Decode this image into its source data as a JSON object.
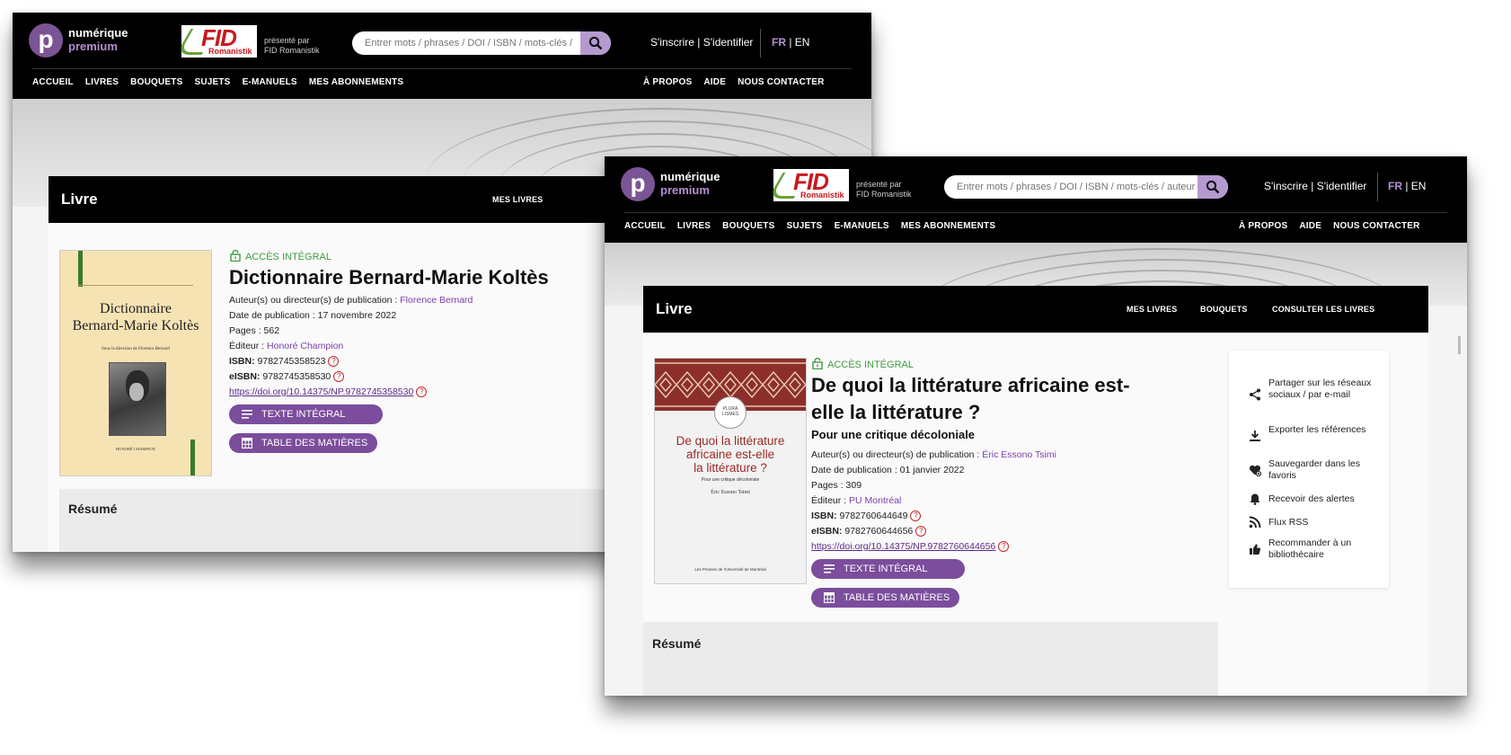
{
  "common": {
    "logo_line1": "numérique",
    "logo_line2": "premium",
    "fid_word": "FID",
    "fid_sub": "Romanistik",
    "presented_line1": "présenté par",
    "presented_line2": "FID Romanistik",
    "search_placeholder": "Entrer mots / phrases / DOI / ISBN / mots-clés / auteur",
    "signin": "S'inscrire | S'identifier",
    "lang_fr": "FR",
    "lang_sep": " | ",
    "lang_en": "EN",
    "nav_left": [
      "ACCUEIL",
      "LIVRES",
      "BOUQUETS",
      "SUJETS",
      "E-MANUELS",
      "MES ABONNEMENTS"
    ],
    "nav_right": [
      "À PROPOS",
      "AIDE",
      "NOUS CONTACTER"
    ],
    "page_heading": "Livre",
    "access_label": "ACCÈS INTÉGRAL",
    "btn_fulltext": "TEXTE INTÉGRAL",
    "btn_toc": "TABLE DES MATIÈRES",
    "resume_label": "Résumé",
    "label_authors": "Auteur(s) ou directeur(s) de publication : ",
    "label_date": "Date de publication : ",
    "label_pages": "Pages : ",
    "label_publisher": "Éditeur : ",
    "label_isbn": "ISBN:",
    "label_eisbn": "eISBN:",
    "help_glyph": "?"
  },
  "book1": {
    "section_links": [
      "MES LIVRES"
    ],
    "title": "Dictionnaire Bernard-Marie Koltès",
    "author": "Florence Bernard",
    "date": "17 novembre 2022",
    "pages": "562",
    "publisher": "Honoré Champion",
    "isbn": "9782745358523",
    "eisbn": "9782745358530",
    "doi": "https://doi.org/10.14375/NP.9782745358530",
    "cover": {
      "title_line1": "Dictionnaire",
      "title_line2": "Bernard-Marie Koltès",
      "byline": "Sous la direction de Florence Bernard",
      "publisher": "HONORÉ CHAMPION",
      "bg": "#f6e3b4",
      "accent": "#3a7a2a"
    }
  },
  "book2": {
    "section_links": [
      "MES LIVRES",
      "BOUQUETS",
      "CONSULTER LES LIVRES"
    ],
    "title_line1": "De quoi la littérature africaine est-",
    "title_line2": "elle la littérature ?",
    "subtitle": "Pour une critique décoloniale",
    "author": "Éric Essono Tsimi",
    "date": "01 janvier 2022",
    "pages": "309",
    "publisher": "PU Montréal",
    "isbn": "9782760644649",
    "eisbn": "9782760644656",
    "doi": "https://doi.org/10.14375/NP.9782760644656",
    "cover": {
      "series_line1": "PLURA",
      "series_line2": "LISMES",
      "title_line1": "De quoi la littérature",
      "title_line2": "africaine est-elle",
      "title_line3": "la littérature ?",
      "subtitle": "Pour une critique décoloniale",
      "author": "Éric Essono Tsimi",
      "publisher": "Les Presses de l'Université de Montréal",
      "pattern_color": "#8c2f2a",
      "title_color": "#9b2a25"
    },
    "side_actions": [
      {
        "icon": "share-icon",
        "label": "Partager sur les réseaux sociaux / par e-mail"
      },
      {
        "icon": "download-icon",
        "label": "Exporter les références"
      },
      {
        "icon": "heart-icon",
        "label": "Sauvegarder dans les favoris"
      },
      {
        "icon": "bell-icon",
        "label": "Recevoir des alertes"
      },
      {
        "icon": "rss-icon",
        "label": "Flux RSS"
      },
      {
        "icon": "thumbs-up-icon",
        "label": "Recommander à un bibliothécaire"
      }
    ]
  },
  "colors": {
    "brand_purple": "#7b4d9c",
    "link_purple": "#7b3fa8",
    "access_green": "#3f9c3f",
    "help_red": "#c62828"
  }
}
